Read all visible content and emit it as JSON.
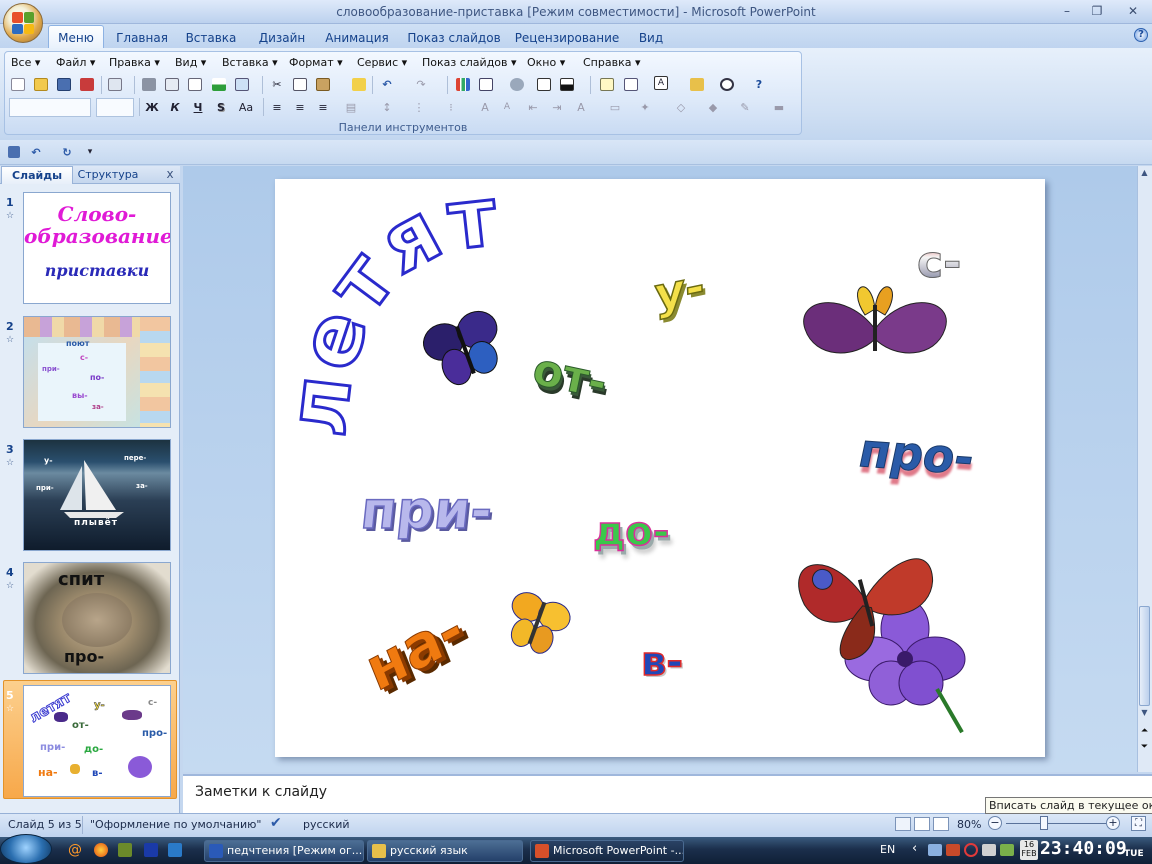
{
  "window": {
    "title": "словообразование-приставка [Режим совместимости] - Microsoft PowerPoint",
    "controls": {
      "minimize": "–",
      "restore": "❐",
      "close": "✕"
    }
  },
  "tabs": [
    "Меню",
    "Главная",
    "Вставка",
    "Дизайн",
    "Анимация",
    "Показ слайдов",
    "Рецензирование",
    "Вид"
  ],
  "active_tab": "Меню",
  "help_icon": "?",
  "menu": [
    "Все ▾",
    "Файл ▾",
    "Правка ▾",
    "Вид ▾",
    "Вставка ▾",
    "Формат ▾",
    "Сервис ▾",
    "Показ слайдов ▾",
    "Окно ▾",
    "Справка ▾"
  ],
  "ribbon": {
    "group_label": "Панели инструментов",
    "format_buttons": [
      "Ж",
      "К",
      "Ч",
      "S",
      "Aa"
    ]
  },
  "panel": {
    "tab_slides": "Слайды",
    "tab_outline": "Структура",
    "close": "x"
  },
  "slides": [
    {
      "number": "1",
      "title_line1": "Слово-",
      "title_line2": "образование",
      "subtitle": "приставки"
    },
    {
      "number": "2",
      "words": [
        "поют",
        "с-",
        "при-",
        "по-",
        "вы-",
        "за-"
      ]
    },
    {
      "number": "3",
      "words": [
        "у-",
        "пере-",
        "при-",
        "за-",
        "плывёт"
      ]
    },
    {
      "number": "4",
      "words": [
        "спит",
        "про-"
      ]
    },
    {
      "number": "5"
    }
  ],
  "current_slide": {
    "arc_word": "летят",
    "prefixes": [
      "у-",
      "с-",
      "от-",
      "про-",
      "при-",
      "до-",
      "на-",
      "в-"
    ]
  },
  "notes_placeholder": "Заметки к слайду",
  "status": {
    "slide_info": "Слайд 5 из 5",
    "theme": "\"Оформление по умолчанию\"",
    "language": "русский",
    "zoom": "80%",
    "zoom_minus": "−",
    "zoom_plus": "+",
    "tooltip": "Вписать слайд в текущее окно"
  },
  "taskbar": {
    "tasks": [
      "педчтения [Режим ог...",
      "русский язык",
      "Microsoft PowerPoint -..."
    ],
    "lang": "EN",
    "time": "23:40:09",
    "date_day": "16",
    "date_month": "FEB",
    "weekday": "TUE"
  },
  "colors": {
    "accent_magenta": "#e01ad6",
    "accent_blue": "#2a2ab8",
    "ribbon_blue": "#15428b"
  }
}
